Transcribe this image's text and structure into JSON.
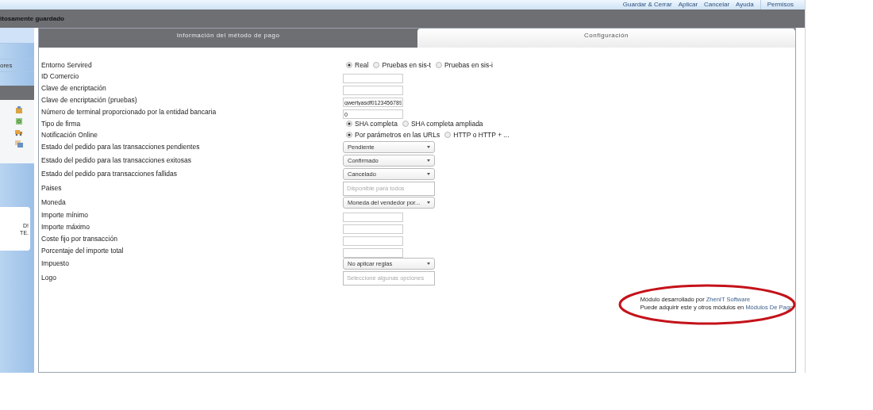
{
  "toolbar": {
    "buttons": [
      {
        "label": "Guardar & Cerrar"
      },
      {
        "label": "Aplicar"
      },
      {
        "label": "Cancelar"
      },
      {
        "label": "Ayuda"
      },
      {
        "label": "Permisos"
      }
    ]
  },
  "message": "itosamente guardado",
  "sidebar": {
    "menu_item": "ores",
    "notice": [
      "D!",
      "TE."
    ]
  },
  "tabs": [
    {
      "label": "Información del método de pago",
      "selected": false
    },
    {
      "label": "Configuración",
      "selected": true
    }
  ],
  "form": [
    {
      "kind": "radio",
      "label": "Entorno Servired",
      "options": [
        {
          "label": "Real",
          "selected": true
        },
        {
          "label": "Pruebas en sis-t",
          "selected": false
        },
        {
          "label": "Pruebas en sis-i",
          "selected": false
        }
      ]
    },
    {
      "kind": "text",
      "label": "ID Comercio"
    },
    {
      "kind": "text",
      "label": "Clave de encriptación"
    },
    {
      "kind": "text",
      "label": "Clave de encriptación (pruebas)",
      "value": "qwertyasdf0123456789"
    },
    {
      "kind": "text",
      "label": "Número de terminal proporcionado por la entidad bancaria",
      "value": "0"
    },
    {
      "kind": "radio",
      "label": "Tipo de firma",
      "options": [
        {
          "label": "SHA completa",
          "selected": true
        },
        {
          "label": "SHA completa ampliada",
          "selected": false
        }
      ]
    },
    {
      "kind": "radio",
      "label": "Notificación Online",
      "options": [
        {
          "label": "Por parámetros en las URLs",
          "selected": true
        },
        {
          "label": "HTTP o HTTP + ...",
          "selected": false
        }
      ]
    },
    {
      "kind": "select",
      "label": "Estado del pedido para las transacciones pendientes",
      "value": "Pendiente"
    },
    {
      "kind": "select",
      "label": "Estado del pedido para las transacciones exitosas",
      "value": "Confirmado"
    },
    {
      "kind": "select",
      "label": "Estado del pedido para transacciones fallidas",
      "value": "Cancelado"
    },
    {
      "kind": "multiselect",
      "label": "Paises",
      "placeholder": "Disponible para todos"
    },
    {
      "kind": "select",
      "label": "Moneda",
      "value": "Moneda del vendedor por..."
    },
    {
      "kind": "text",
      "label": "Importe mínimo"
    },
    {
      "kind": "text",
      "label": "Importe máximo"
    },
    {
      "kind": "text",
      "label": "Coste fijo por transacción"
    },
    {
      "kind": "text",
      "label": "Porcentaje del importe total"
    },
    {
      "kind": "select",
      "label": "Impuesto",
      "value": "No aplicar reglas"
    },
    {
      "kind": "multiselect",
      "label": "Logo",
      "placeholder": "Seleccione algunas opciones"
    }
  ],
  "footer": [
    {
      "text": "Módulo desarrollado por ",
      "link": "ZhenIT Software"
    },
    {
      "text": "Puede adquirir este y otros módulos en ",
      "link": "Módulos De Pago"
    }
  ]
}
